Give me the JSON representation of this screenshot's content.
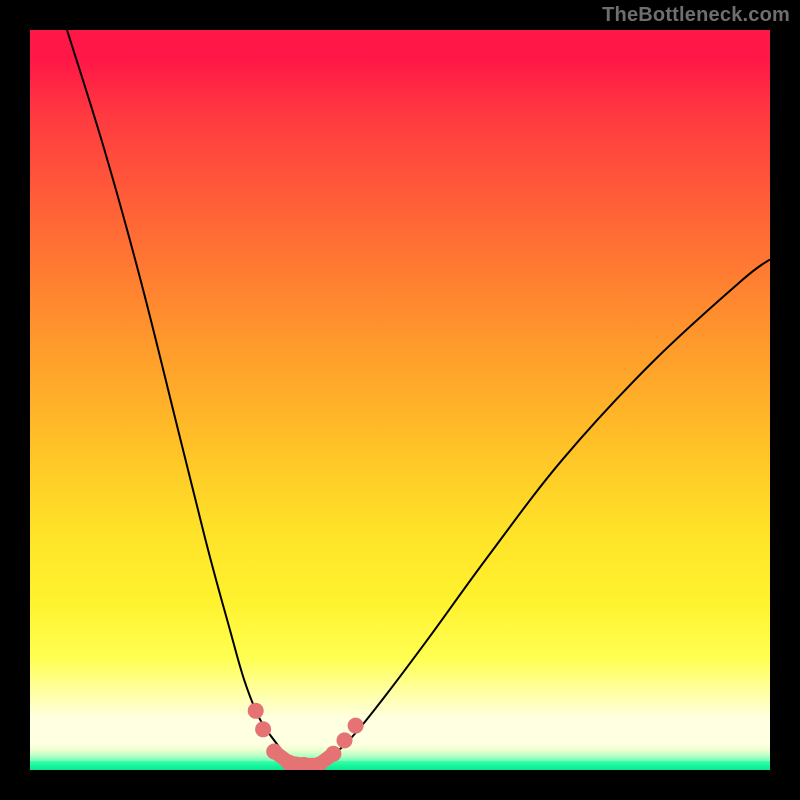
{
  "watermark": "TheBottleneck.com",
  "colors": {
    "frame": "#000000",
    "grad_top": "#ff1747",
    "grad_mid1": "#ff9a2c",
    "grad_mid2": "#ffe228",
    "grad_low": "#ffffa8",
    "green": "#14f59a",
    "curve": "#000000",
    "marker": "#e57373"
  },
  "chart_data": {
    "type": "line",
    "title": "",
    "xlabel": "",
    "ylabel": "",
    "xlim": [
      0,
      100
    ],
    "ylim": [
      0,
      100
    ],
    "note": "Two curved lines descending into a V-shaped minimum near x≈36 at y≈0, with pink marker dots clustered around the minimum. No numeric axis ticks are shown; values are visual estimates in percent of plot area (origin at bottom-left).",
    "series": [
      {
        "name": "left-curve",
        "x": [
          5,
          10,
          15,
          20,
          24,
          27,
          29,
          31,
          33,
          35,
          36
        ],
        "y": [
          100,
          84,
          66,
          46,
          30,
          19,
          12,
          7,
          4,
          1.5,
          0.5
        ]
      },
      {
        "name": "right-curve",
        "x": [
          39,
          41,
          44,
          48,
          54,
          62,
          72,
          84,
          96,
          100
        ],
        "y": [
          0.5,
          2,
          5,
          10,
          18,
          29,
          42,
          55,
          66,
          69
        ]
      }
    ],
    "markers": [
      {
        "x": 30.5,
        "y": 8
      },
      {
        "x": 31.5,
        "y": 5.5
      },
      {
        "x": 33,
        "y": 2.5
      },
      {
        "x": 35,
        "y": 1
      },
      {
        "x": 37,
        "y": 0.7
      },
      {
        "x": 39,
        "y": 0.7
      },
      {
        "x": 41,
        "y": 2.2
      },
      {
        "x": 42.5,
        "y": 4
      },
      {
        "x": 44,
        "y": 6
      }
    ],
    "trough_path": [
      {
        "x": 33,
        "y": 2.5
      },
      {
        "x": 35,
        "y": 1
      },
      {
        "x": 37,
        "y": 0.7
      },
      {
        "x": 39,
        "y": 0.7
      },
      {
        "x": 41,
        "y": 2.2
      }
    ]
  }
}
